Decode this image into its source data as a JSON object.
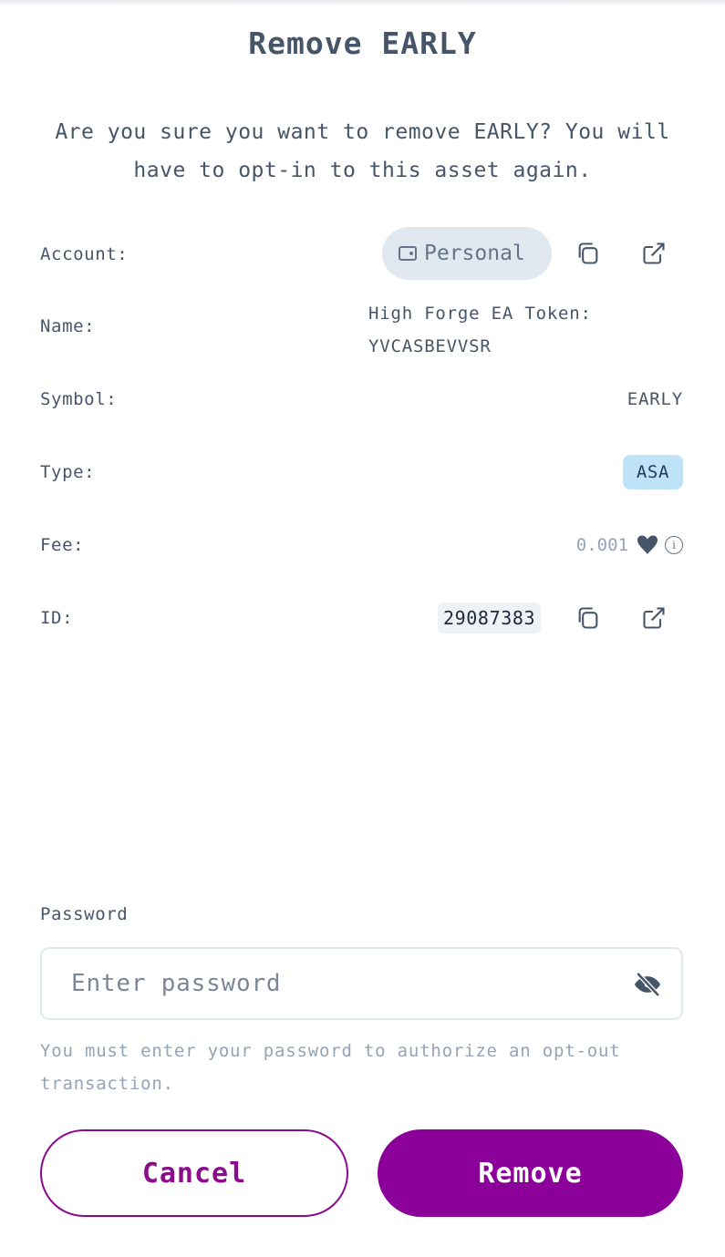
{
  "dialog": {
    "title": "Remove EARLY",
    "message": "Are you sure you want to remove EARLY? You will have to opt-in to this asset again."
  },
  "details": {
    "account": {
      "label": "Account:",
      "value": "Personal"
    },
    "name": {
      "label": "Name:",
      "value": "High Forge EA Token: YVCASBEVVSR"
    },
    "symbol": {
      "label": "Symbol:",
      "value": "EARLY"
    },
    "type": {
      "label": "Type:",
      "value": "ASA"
    },
    "fee": {
      "label": "Fee:",
      "value": "0.001",
      "info_icon_text": "i"
    },
    "id": {
      "label": "ID:",
      "value": "29087383"
    }
  },
  "password": {
    "label": "Password",
    "placeholder": "Enter password",
    "helper": "You must enter your password to authorize an opt-out transaction."
  },
  "actions": {
    "cancel_label": "Cancel",
    "remove_label": "Remove"
  },
  "colors": {
    "primary": "#8b0098",
    "text": "#475569",
    "badge_bg": "#bee3f8",
    "pill_bg": "#e2e8f0"
  },
  "icons": [
    "wallet-icon",
    "copy-icon",
    "external-link-icon",
    "algo-icon",
    "info-icon",
    "eye-off-icon"
  ]
}
